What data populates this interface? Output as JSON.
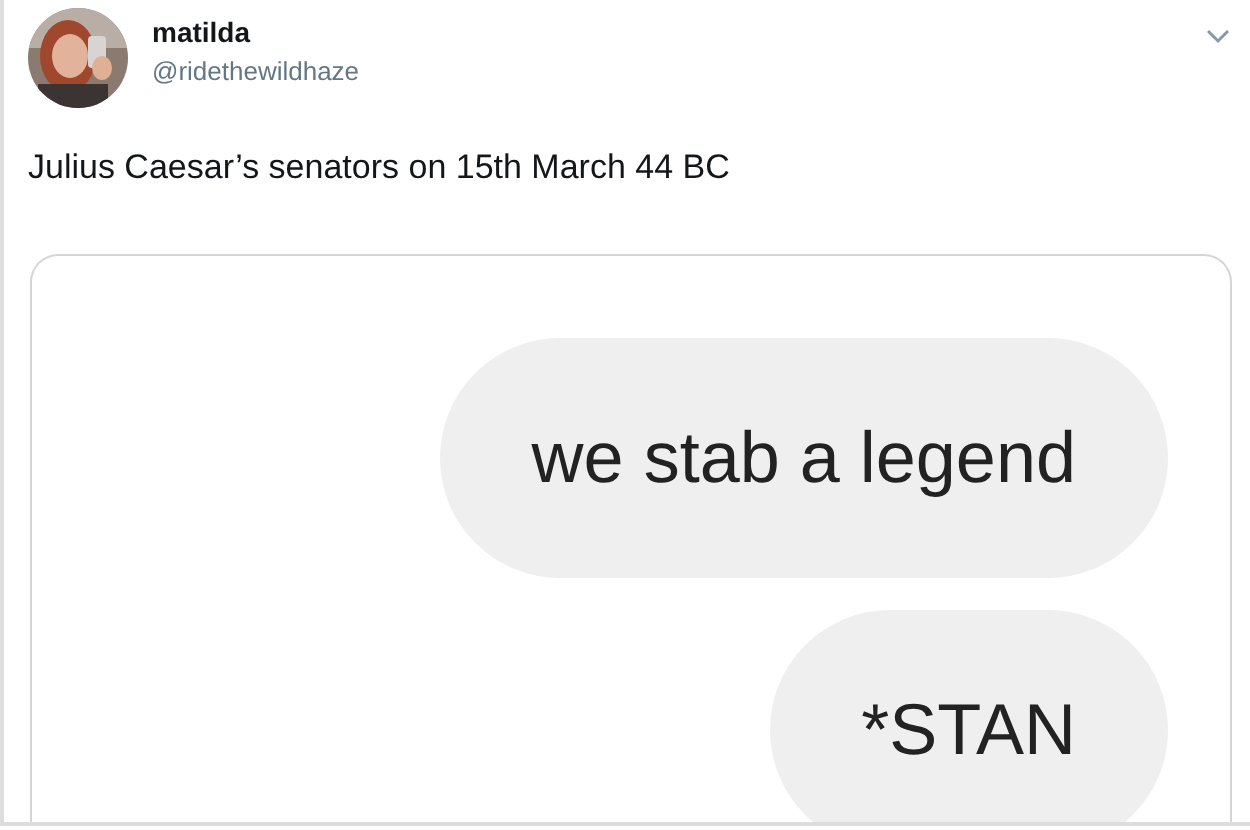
{
  "tweet": {
    "author": {
      "name": "matilda",
      "handle": "@ridethewildhaze"
    },
    "text": "Julius Caesar’s senators on 15th March 44 BC",
    "media": {
      "messages": [
        {
          "text": "we stab a legend"
        },
        {
          "text": "*STAN"
        }
      ]
    }
  }
}
